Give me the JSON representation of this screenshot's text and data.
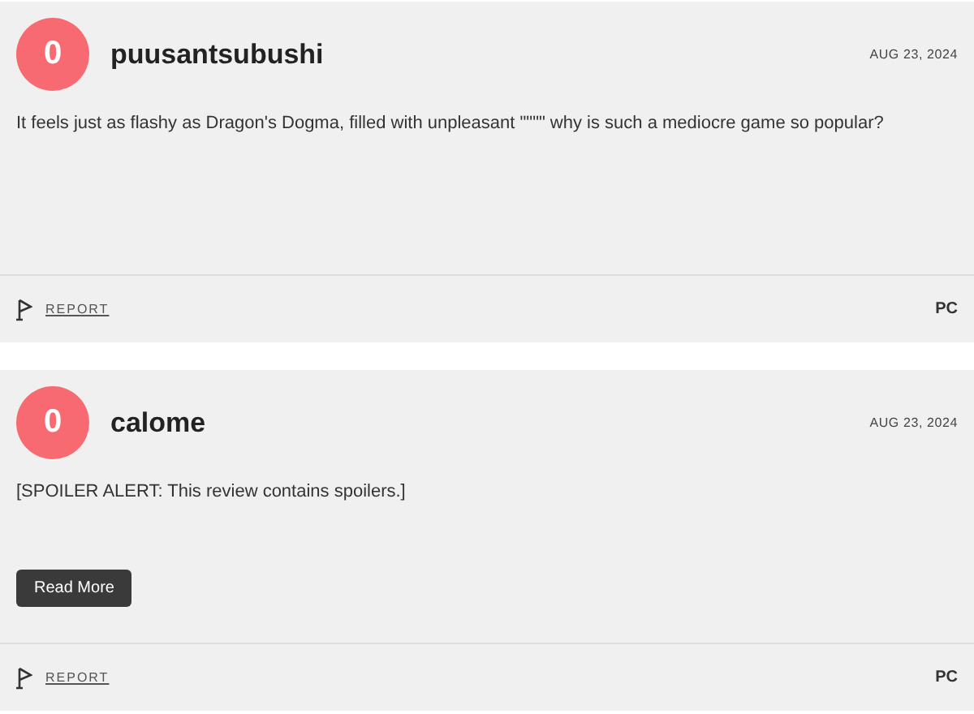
{
  "reviews": [
    {
      "avatar": "0",
      "username": "puusantsubushi",
      "date": "AUG 23, 2024",
      "text": "It feels just as flashy as Dragon's Dogma, filled with unpleasant \"\"\"\" why is such a mediocre game so popular?",
      "report": "REPORT",
      "platform": "PC"
    },
    {
      "avatar": "0",
      "username": "calome",
      "date": "AUG 23, 2024",
      "text": "[SPOILER ALERT: This review contains spoilers.]",
      "read_more": "Read More",
      "report": "REPORT",
      "platform": "PC"
    }
  ]
}
